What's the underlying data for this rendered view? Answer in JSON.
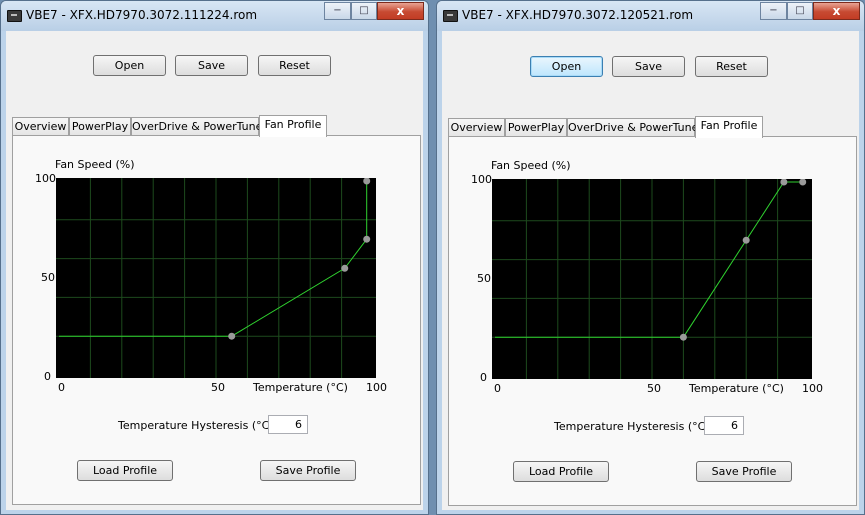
{
  "windows": [
    {
      "title": "VBE7 - XFX.HD7970.3072.111224.rom",
      "caption": {
        "minimize": "−",
        "maximize": "□",
        "close": "x"
      },
      "buttons": {
        "open": "Open",
        "save": "Save",
        "reset": "Reset"
      },
      "open_focused": false,
      "tabs": [
        "Overview",
        "PowerPlay",
        "OverDrive & PowerTune",
        "Fan Profile"
      ],
      "active_tab": 3,
      "chart_data": {
        "type": "line",
        "ylabel": "Fan Speed (%)",
        "xlabel": "Temperature (°C)",
        "xlim": [
          0,
          100
        ],
        "ylim": [
          0,
          100
        ],
        "x_ticks": [
          "0",
          "50",
          "100"
        ],
        "y_ticks": [
          "0",
          "50",
          "100"
        ],
        "grid": true,
        "colors": {
          "background": "#000000",
          "grid": "#1d4a1d",
          "line": "#2fd12f",
          "point": "#9a9a9a"
        },
        "points": [
          {
            "x": 0,
            "y": 20,
            "marker": false
          },
          {
            "x": 55,
            "y": 20,
            "marker": true
          },
          {
            "x": 91,
            "y": 55,
            "marker": true
          },
          {
            "x": 98,
            "y": 70,
            "marker": true
          },
          {
            "x": 98,
            "y": 100,
            "marker": true
          }
        ]
      },
      "hysteresis": {
        "label": "Temperature Hysteresis (°C)",
        "value": "6"
      },
      "profile_buttons": {
        "load": "Load Profile",
        "save": "Save Profile"
      }
    },
    {
      "title": "VBE7 - XFX.HD7970.3072.120521.rom",
      "caption": {
        "minimize": "−",
        "maximize": "□",
        "close": "x"
      },
      "buttons": {
        "open": "Open",
        "save": "Save",
        "reset": "Reset"
      },
      "open_focused": true,
      "tabs": [
        "Overview",
        "PowerPlay",
        "OverDrive & PowerTune",
        "Fan Profile"
      ],
      "active_tab": 3,
      "chart_data": {
        "type": "line",
        "ylabel": "Fan Speed (%)",
        "xlabel": "Temperature (°C)",
        "xlim": [
          0,
          100
        ],
        "ylim": [
          0,
          100
        ],
        "x_ticks": [
          "0",
          "50",
          "100"
        ],
        "y_ticks": [
          "0",
          "50",
          "100"
        ],
        "grid": true,
        "colors": {
          "background": "#000000",
          "grid": "#1d4a1d",
          "line": "#2fd12f",
          "point": "#9a9a9a"
        },
        "points": [
          {
            "x": 0,
            "y": 20,
            "marker": false
          },
          {
            "x": 60,
            "y": 20,
            "marker": true
          },
          {
            "x": 80,
            "y": 70,
            "marker": true
          },
          {
            "x": 92,
            "y": 100,
            "marker": true
          },
          {
            "x": 98,
            "y": 100,
            "marker": true
          }
        ]
      },
      "hysteresis": {
        "label": "Temperature Hysteresis (°C)",
        "value": "6"
      },
      "profile_buttons": {
        "load": "Load Profile",
        "save": "Save Profile"
      }
    }
  ]
}
